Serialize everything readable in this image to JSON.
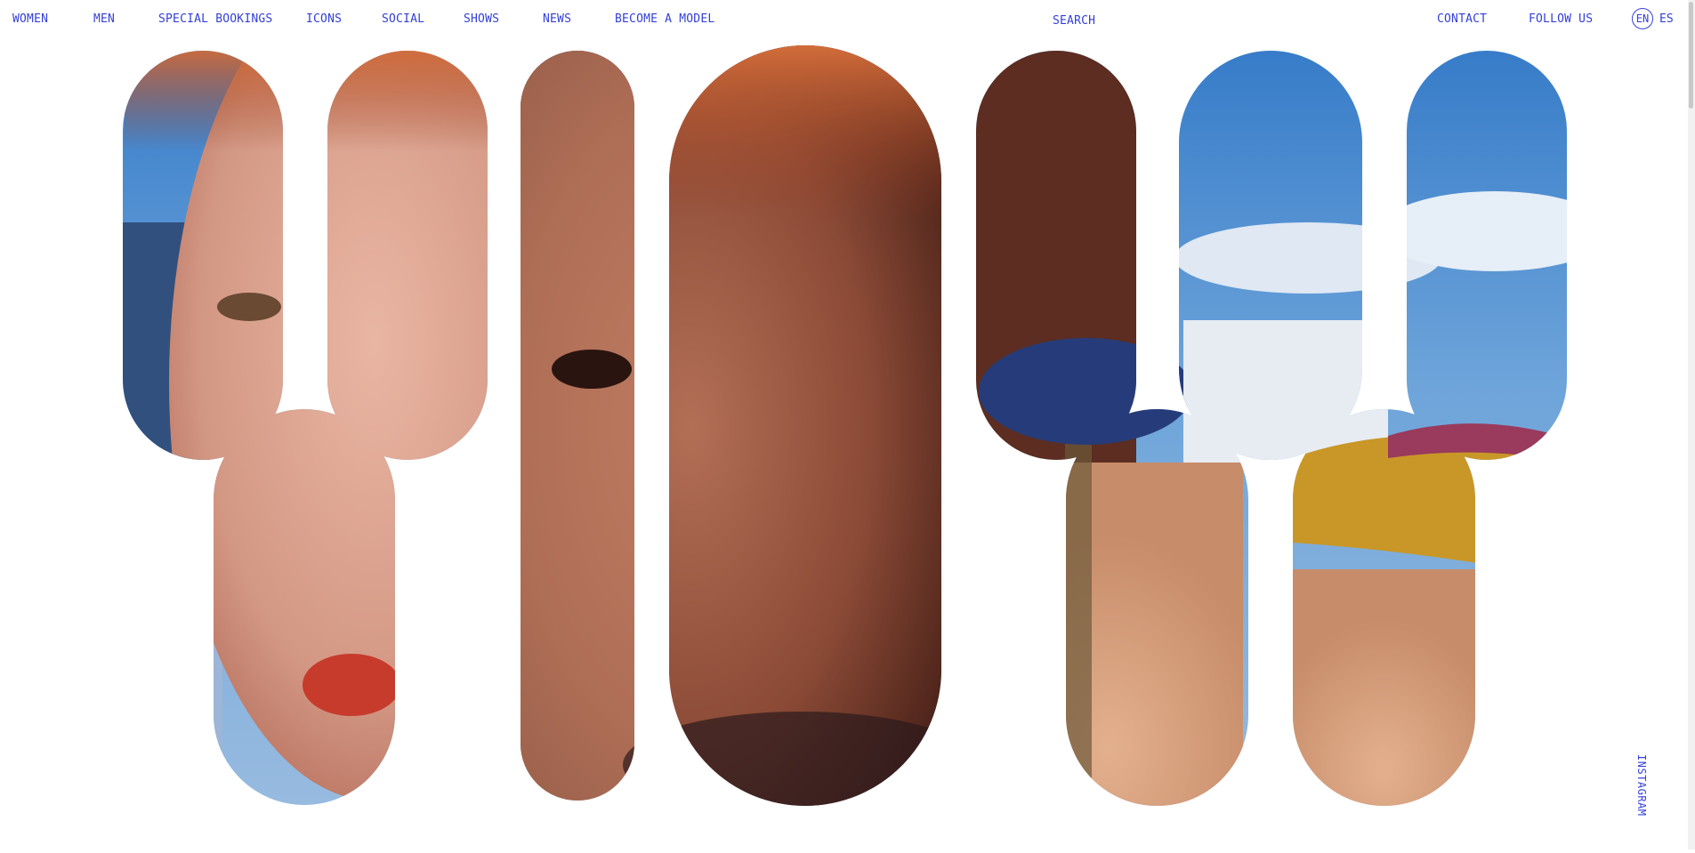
{
  "nav": {
    "left": [
      {
        "label": "WOMEN"
      },
      {
        "label": "MEN"
      },
      {
        "label": "SPECIAL BOOKINGS"
      },
      {
        "label": "ICONS"
      },
      {
        "label": "SOCIAL"
      },
      {
        "label": "SHOWS"
      },
      {
        "label": "NEWS"
      },
      {
        "label": "BECOME A MODEL"
      }
    ],
    "search_label": "SEARCH",
    "contact_label": "CONTACT",
    "follow_label": "FOLLOW US",
    "lang_active": "EN",
    "lang_other": "ES"
  },
  "hero": {
    "photo_description": "close-up fashion portraits with blue sky, shown through large rounded letterforms",
    "side_link": "INSTAGRAM"
  },
  "colors": {
    "accent": "#3340d8",
    "background": "#ffffff"
  }
}
